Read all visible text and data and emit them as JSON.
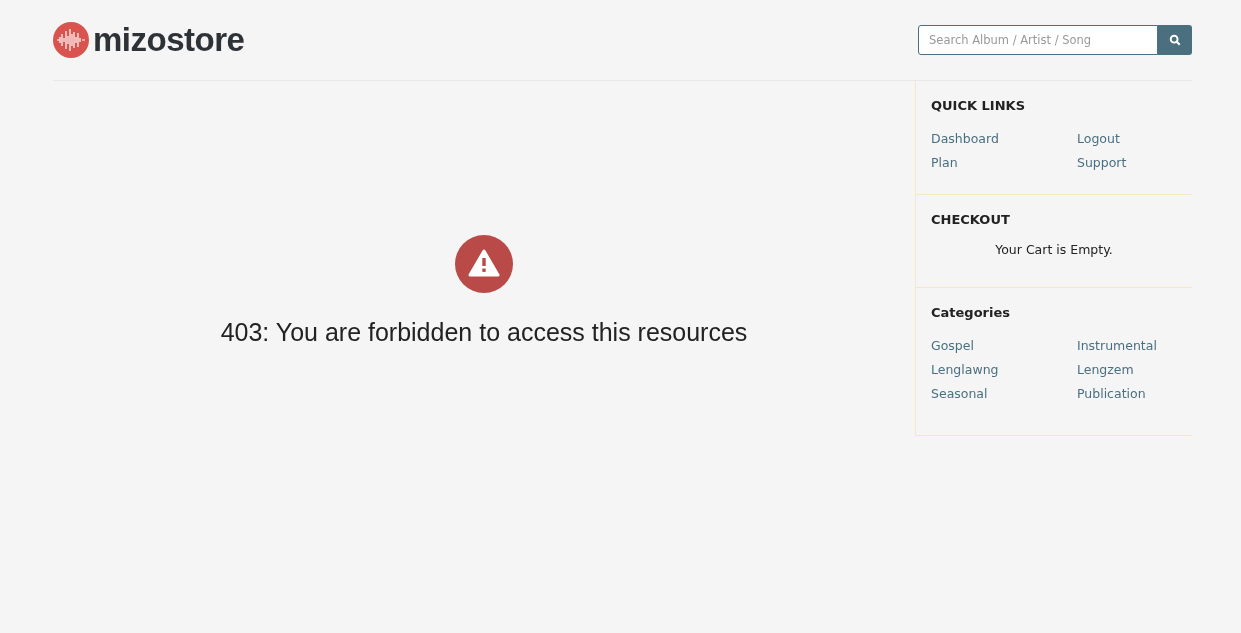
{
  "logo": {
    "text": "mizostore"
  },
  "search": {
    "placeholder": "Search Album / Artist / Song"
  },
  "error": {
    "message": "403: You are forbidden to access this resources"
  },
  "sidebar": [
    {
      "kind": "links",
      "title": "QUICK LINKS",
      "items": [
        "Dashboard",
        "Logout",
        "Plan",
        "Support"
      ]
    },
    {
      "kind": "text",
      "title": "CHECKOUT",
      "text": "Your Cart is Empty."
    },
    {
      "kind": "links",
      "title": "Categories",
      "items": [
        "Gospel",
        "Instrumental",
        "Lenglawng",
        "Lengzem",
        "Seasonal",
        "Publication"
      ]
    }
  ]
}
